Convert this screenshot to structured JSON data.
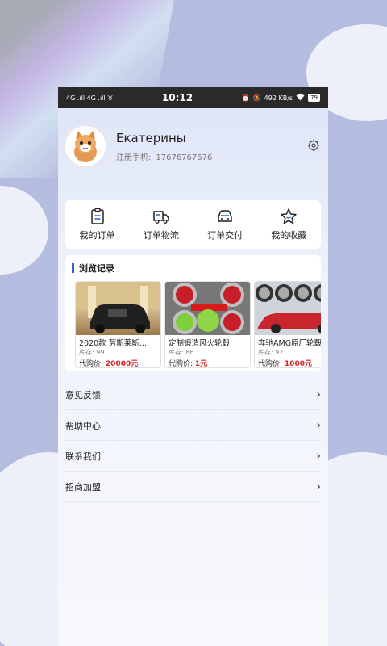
{
  "status_bar": {
    "left": "4G .ıll 4G .ıll ♉",
    "time": "10:12",
    "speed": "492 KB/s",
    "battery": "79"
  },
  "profile": {
    "name": "Екатерины",
    "phone_label": "注册手机:",
    "phone": "17676767676"
  },
  "orders": [
    {
      "label": "我的订单",
      "icon": "clipboard-icon"
    },
    {
      "label": "订单物流",
      "icon": "truck-icon"
    },
    {
      "label": "订单交付",
      "icon": "car-icon"
    },
    {
      "label": "我的收藏",
      "icon": "star-icon"
    }
  ],
  "history": {
    "title": "浏览记录",
    "products": [
      {
        "name": "2020款 劳斯莱斯…",
        "stock": "库存: 99",
        "price_label": "代购价:",
        "price": "20000元"
      },
      {
        "name": "定制锻造风火轮毂",
        "stock": "库存: 86",
        "price_label": "代购价:",
        "price": "1元"
      },
      {
        "name": "奔驰AMG原厂轮毂",
        "stock": "库存: 97",
        "price_label": "代购价:",
        "price": "1000元"
      }
    ]
  },
  "menu": [
    {
      "label": "意见反馈"
    },
    {
      "label": "帮助中心"
    },
    {
      "label": "联系我们"
    },
    {
      "label": "招商加盟"
    }
  ],
  "colors": {
    "accent": "#2d66c4",
    "price": "#e21f1f",
    "statusbar": "#2a2a2a"
  }
}
